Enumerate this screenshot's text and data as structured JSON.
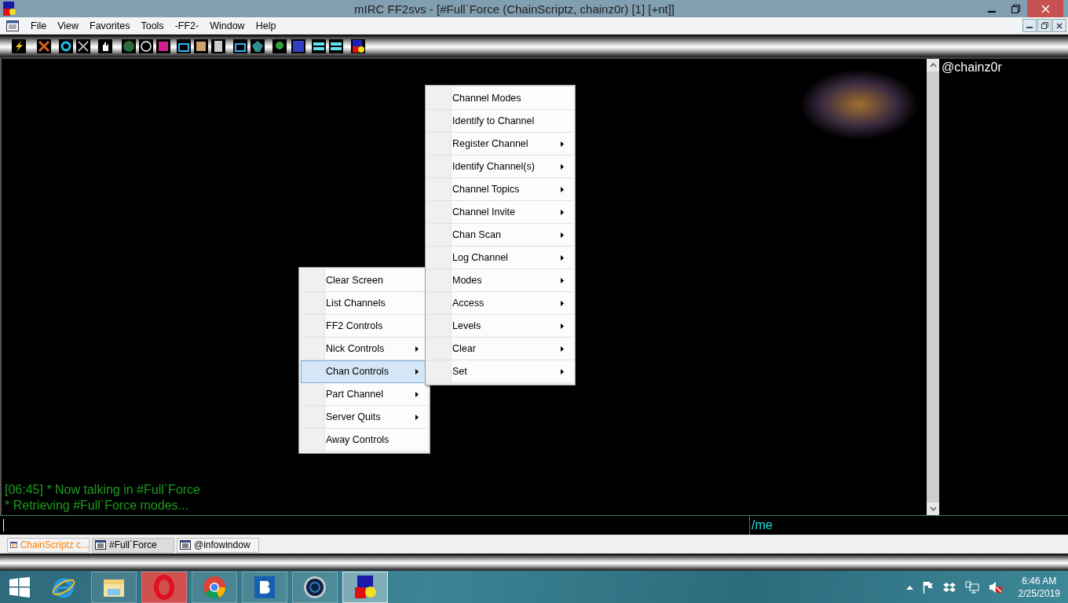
{
  "window": {
    "title": "mIRC FF2svs - [#Full`Force (ChainScriptz, chainz0r) [1] [+nt]]"
  },
  "menu_bar": [
    "File",
    "View",
    "Favorites",
    "Tools",
    "-FF2-",
    "Window",
    "Help"
  ],
  "chat": {
    "lines": [
      "[06:45] * Now talking in #Full`Force",
      "* Retrieving #Full`Force modes..."
    ]
  },
  "nicklist": [
    "@chainz0r"
  ],
  "input": {
    "command": "/me"
  },
  "popup_menu": {
    "items": [
      {
        "label": "Clear Screen",
        "submenu": false,
        "selected": false
      },
      {
        "label": "List Channels",
        "submenu": false,
        "selected": false
      },
      {
        "label": "FF2 Controls",
        "submenu": false,
        "selected": false
      },
      {
        "label": "Nick Controls",
        "submenu": true,
        "selected": false
      },
      {
        "label": "Chan Controls",
        "submenu": true,
        "selected": true
      },
      {
        "label": "Part Channel",
        "submenu": true,
        "selected": false
      },
      {
        "label": "Server Quits",
        "submenu": true,
        "selected": false
      },
      {
        "label": "Away Controls",
        "submenu": false,
        "selected": false
      }
    ]
  },
  "submenu": {
    "items": [
      {
        "label": "Channel Modes",
        "submenu": false,
        "selected": false
      },
      {
        "label": "Identify to Channel",
        "submenu": false,
        "selected": false
      },
      {
        "label": "Register Channel",
        "submenu": true,
        "selected": false
      },
      {
        "label": "Identify Channel(s)",
        "submenu": true,
        "selected": false
      },
      {
        "label": "Channel Topics",
        "submenu": true,
        "selected": false
      },
      {
        "label": "Channel Invite",
        "submenu": true,
        "selected": false
      },
      {
        "label": "Chan Scan",
        "submenu": true,
        "selected": false
      },
      {
        "label": "Log Channel",
        "submenu": true,
        "selected": false
      },
      {
        "label": "Modes",
        "submenu": true,
        "selected": false
      },
      {
        "label": "Access",
        "submenu": true,
        "selected": false
      },
      {
        "label": "Levels",
        "submenu": true,
        "selected": false
      },
      {
        "label": "Clear",
        "submenu": true,
        "selected": false
      },
      {
        "label": "Set",
        "submenu": true,
        "selected": false
      }
    ]
  },
  "window_tabs": [
    {
      "label": "ChainScriptz c...",
      "selected": false,
      "color": "#ff8000"
    },
    {
      "label": "#Full`Force",
      "selected": true,
      "color": "#000000"
    },
    {
      "label": "@infowindow",
      "selected": false,
      "color": "#000000"
    }
  ],
  "taskbar": {
    "apps": [
      {
        "kind": "ie",
        "selected": false
      },
      {
        "kind": "folder",
        "selected": false
      },
      {
        "kind": "opera",
        "selected": false
      },
      {
        "kind": "chrome",
        "selected": false
      },
      {
        "kind": "b",
        "selected": false
      },
      {
        "kind": "disc",
        "selected": false
      },
      {
        "kind": "mirc",
        "selected": true
      }
    ]
  },
  "clock": {
    "time": "6:46 AM",
    "date": "2/25/2019"
  }
}
